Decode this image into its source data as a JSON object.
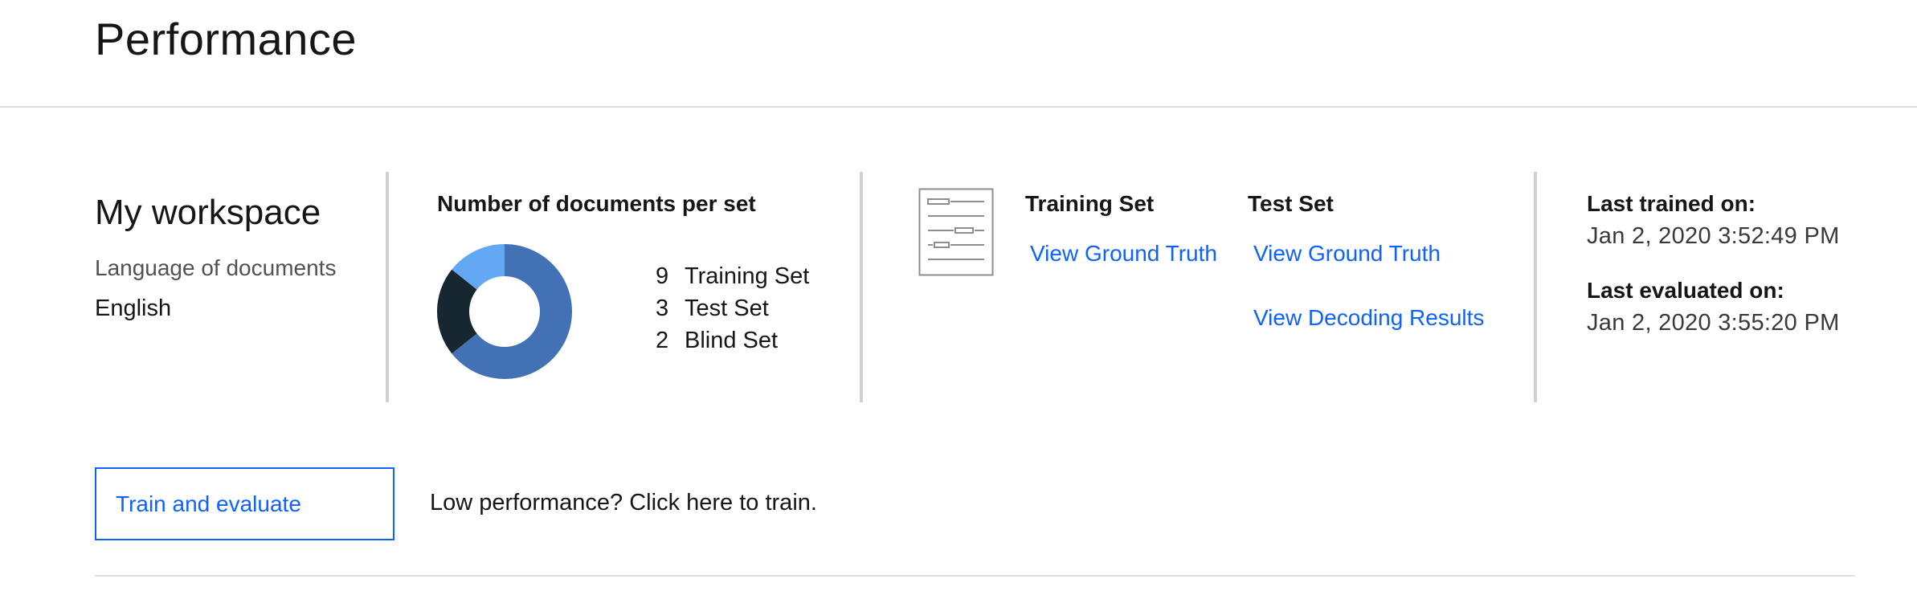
{
  "page": {
    "title": "Performance"
  },
  "workspace": {
    "name": "My workspace",
    "language_label": "Language of documents",
    "language_value": "English"
  },
  "documents": {
    "heading": "Number of documents per set",
    "sets": [
      {
        "count": "9",
        "name": "Training Set",
        "color": "#4272b5"
      },
      {
        "count": "3",
        "name": "Test Set",
        "color": "#162731"
      },
      {
        "count": "2",
        "name": "Blind Set",
        "color": "#62a8f5"
      }
    ]
  },
  "chart_data": {
    "type": "pie",
    "categories": [
      "Training Set",
      "Test Set",
      "Blind Set"
    ],
    "values": [
      9,
      3,
      2
    ],
    "colors": [
      "#4272b5",
      "#162731",
      "#62a8f5"
    ],
    "title": "Number of documents per set"
  },
  "training_set": {
    "heading": "Training Set",
    "view_ground_truth": "View Ground Truth"
  },
  "test_set": {
    "heading": "Test Set",
    "view_ground_truth": "View Ground Truth",
    "view_decoding_results": "View Decoding Results"
  },
  "status": {
    "last_trained_label": "Last trained on:",
    "last_trained_value": "Jan 2, 2020 3:52:49 PM",
    "last_evaluated_label": "Last evaluated on:",
    "last_evaluated_value": "Jan 2, 2020 3:55:20 PM"
  },
  "actions": {
    "train_button": "Train and evaluate",
    "hint": "Low performance? Click here to train."
  },
  "icons": {
    "document": "document-icon"
  }
}
